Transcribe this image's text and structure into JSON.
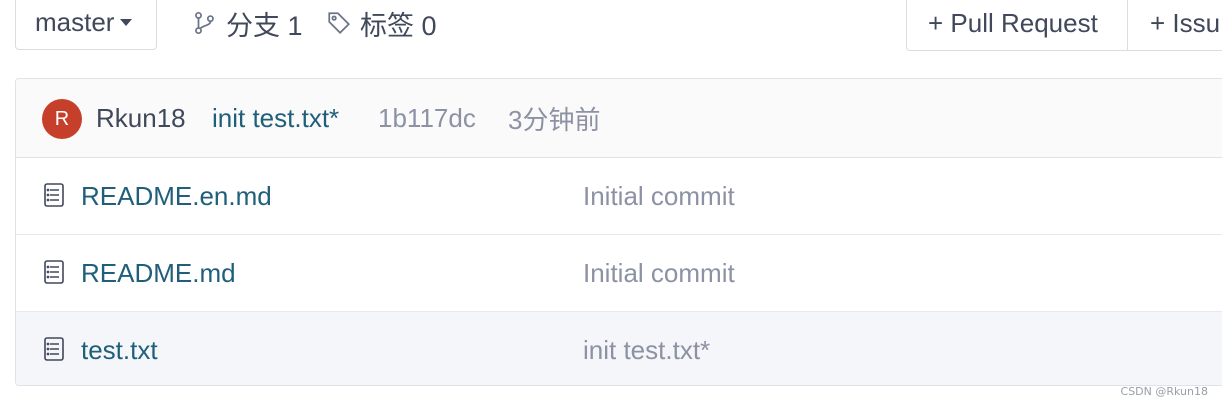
{
  "toolbar": {
    "branch": "master",
    "branches_label": "分支 1",
    "tags_label": "标签 0",
    "pull_request_label": "+ Pull Request",
    "issue_label": "+ Issu"
  },
  "commit": {
    "avatar_letter": "R",
    "author": "Rkun18",
    "message": "init test.txt*",
    "sha": "1b117dc",
    "time": "3分钟前"
  },
  "files": [
    {
      "name": "README.en.md",
      "commit_message": "Initial commit",
      "icon": "file-text-icon"
    },
    {
      "name": "README.md",
      "commit_message": "Initial commit",
      "icon": "file-text-icon"
    },
    {
      "name": "test.txt",
      "commit_message": "init test.txt*",
      "icon": "file-text-icon"
    }
  ],
  "watermark": "CSDN @Rkun18",
  "colors": {
    "link": "#1f5f7a",
    "muted": "#8c92a4",
    "avatar_bg": "#c63f2a"
  }
}
